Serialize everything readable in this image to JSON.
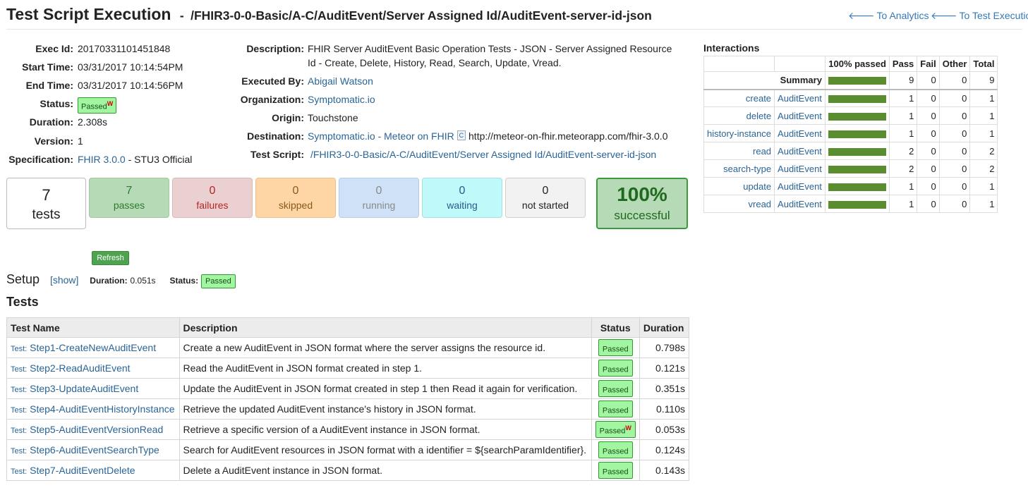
{
  "header": {
    "title": "Test Script Execution",
    "separator": "-",
    "path": "/FHIR3-0-0-Basic/A-C/AuditEvent/Server Assigned Id/AuditEvent-server-id-json",
    "nav_analytics": "To Analytics",
    "nav_test_execution": "To Test Execution"
  },
  "info": {
    "exec_id_label": "Exec Id:",
    "exec_id": "20170331101451848",
    "start_label": "Start Time:",
    "start": "03/31/2017 10:14:54PM",
    "end_label": "End Time:",
    "end": "03/31/2017 10:14:56PM",
    "status_label": "Status:",
    "status": "Passed",
    "status_mark": "W",
    "duration_label": "Duration:",
    "duration": "2.308s",
    "version_label": "Version:",
    "version": "1",
    "spec_label": "Specification:",
    "spec_link": "FHIR 3.0.0",
    "spec_suffix": "- STU3 Official"
  },
  "details": {
    "description_label": "Description:",
    "description_line1": "FHIR Server AuditEvent Basic Operation Tests - JSON - Server Assigned Resource",
    "description_line2": "Id - Create, Delete, History, Read, Search, Update, Vread.",
    "executed_by_label": "Executed By:",
    "executed_by": "Abigail Watson",
    "organization_label": "Organization:",
    "organization": "Symptomatic.io",
    "origin_label": "Origin:",
    "origin": "Touchstone",
    "destination_label": "Destination:",
    "destination_link": "Symptomatic.io - Meteor on FHIR",
    "destination_icon_letter": "C",
    "destination_url": "http://meteor-on-fhir.meteorapp.com/fhir-3.0.0",
    "test_script_label": "Test Script:",
    "test_script": "/FHIR3-0-0-Basic/A-C/AuditEvent/Server Assigned Id/AuditEvent-server-id-json"
  },
  "summary": {
    "tests_num": "7",
    "tests_label": "tests",
    "passes_num": "7",
    "passes_label": "passes",
    "failures_num": "0",
    "failures_label": "failures",
    "skipped_num": "0",
    "skipped_label": "skipped",
    "running_num": "0",
    "running_label": "running",
    "waiting_num": "0",
    "waiting_label": "waiting",
    "not_started_num": "0",
    "not_started_label": "not started",
    "success_pct": "100%",
    "success_label": "successful"
  },
  "refresh_label": "Refresh",
  "setup": {
    "title": "Setup",
    "show_label": "[show]",
    "duration_label": "Duration:",
    "duration": "0.051s",
    "status_label": "Status:",
    "status": "Passed"
  },
  "tests_title": "Tests",
  "tests_table": {
    "headers": [
      "Test Name",
      "Description",
      "Status",
      "Duration"
    ],
    "prefix": "Test:",
    "rows": [
      {
        "name": "Step1-CreateNewAuditEvent",
        "description": "Create a new AuditEvent in JSON format where the server assigns the resource id.",
        "status": "Passed",
        "mark": "",
        "duration": "0.798s"
      },
      {
        "name": "Step2-ReadAuditEvent",
        "description": "Read the AuditEvent in JSON format created in step 1.",
        "status": "Passed",
        "mark": "",
        "duration": "0.121s"
      },
      {
        "name": "Step3-UpdateAuditEvent",
        "description": "Update the AuditEvent in JSON format created in step 1 then Read it again for verification.",
        "status": "Passed",
        "mark": "",
        "duration": "0.351s"
      },
      {
        "name": "Step4-AuditEventHistoryInstance",
        "description": "Retrieve the updated AuditEvent instance's history in JSON format.",
        "status": "Passed",
        "mark": "",
        "duration": "0.110s"
      },
      {
        "name": "Step5-AuditEventVersionRead",
        "description": "Retrieve a specific version of a AuditEvent instance in JSON format.",
        "status": "Passed",
        "mark": "W",
        "duration": "0.053s"
      },
      {
        "name": "Step6-AuditEventSearchType",
        "description": "Search for AuditEvent resources in JSON format with a identifier = ${searchParamIdentifier}.",
        "status": "Passed",
        "mark": "",
        "duration": "0.124s"
      },
      {
        "name": "Step7-AuditEventDelete",
        "description": "Delete a AuditEvent instance in JSON format.",
        "status": "Passed",
        "mark": "",
        "duration": "0.143s"
      }
    ]
  },
  "interactions": {
    "title": "Interactions",
    "headers": [
      "",
      "",
      "100% passed",
      "Pass",
      "Fail",
      "Other",
      "Total"
    ],
    "summary": {
      "label": "Summary",
      "passed_fraction": 1.0,
      "pass": "9",
      "fail": "0",
      "other": "0",
      "total": "9"
    },
    "rows": [
      {
        "op": "create",
        "resource": "AuditEvent",
        "passed_fraction": 1.0,
        "pass": "1",
        "fail": "0",
        "other": "0",
        "total": "1"
      },
      {
        "op": "delete",
        "resource": "AuditEvent",
        "passed_fraction": 1.0,
        "pass": "1",
        "fail": "0",
        "other": "0",
        "total": "1"
      },
      {
        "op": "history-instance",
        "resource": "AuditEvent",
        "passed_fraction": 1.0,
        "pass": "1",
        "fail": "0",
        "other": "0",
        "total": "1"
      },
      {
        "op": "read",
        "resource": "AuditEvent",
        "passed_fraction": 1.0,
        "pass": "2",
        "fail": "0",
        "other": "0",
        "total": "2"
      },
      {
        "op": "search-type",
        "resource": "AuditEvent",
        "passed_fraction": 1.0,
        "pass": "2",
        "fail": "0",
        "other": "0",
        "total": "2"
      },
      {
        "op": "update",
        "resource": "AuditEvent",
        "passed_fraction": 1.0,
        "pass": "1",
        "fail": "0",
        "other": "0",
        "total": "1"
      },
      {
        "op": "vread",
        "resource": "AuditEvent",
        "passed_fraction": 1.0,
        "pass": "1",
        "fail": "0",
        "other": "0",
        "total": "1"
      }
    ]
  },
  "colors": {
    "link": "#337ab7",
    "pass_badge": "#a2f6a2",
    "bar": "#5a8d2f",
    "passes_tile": "#b6dab6",
    "failures_tile": "#ead0d0",
    "skipped_tile": "#fed6a6",
    "running_tile": "#cfe1f7",
    "waiting_tile": "#bff9f9",
    "not_started_tile": "#f2f2f2",
    "success_tile": "#b6dab6"
  }
}
